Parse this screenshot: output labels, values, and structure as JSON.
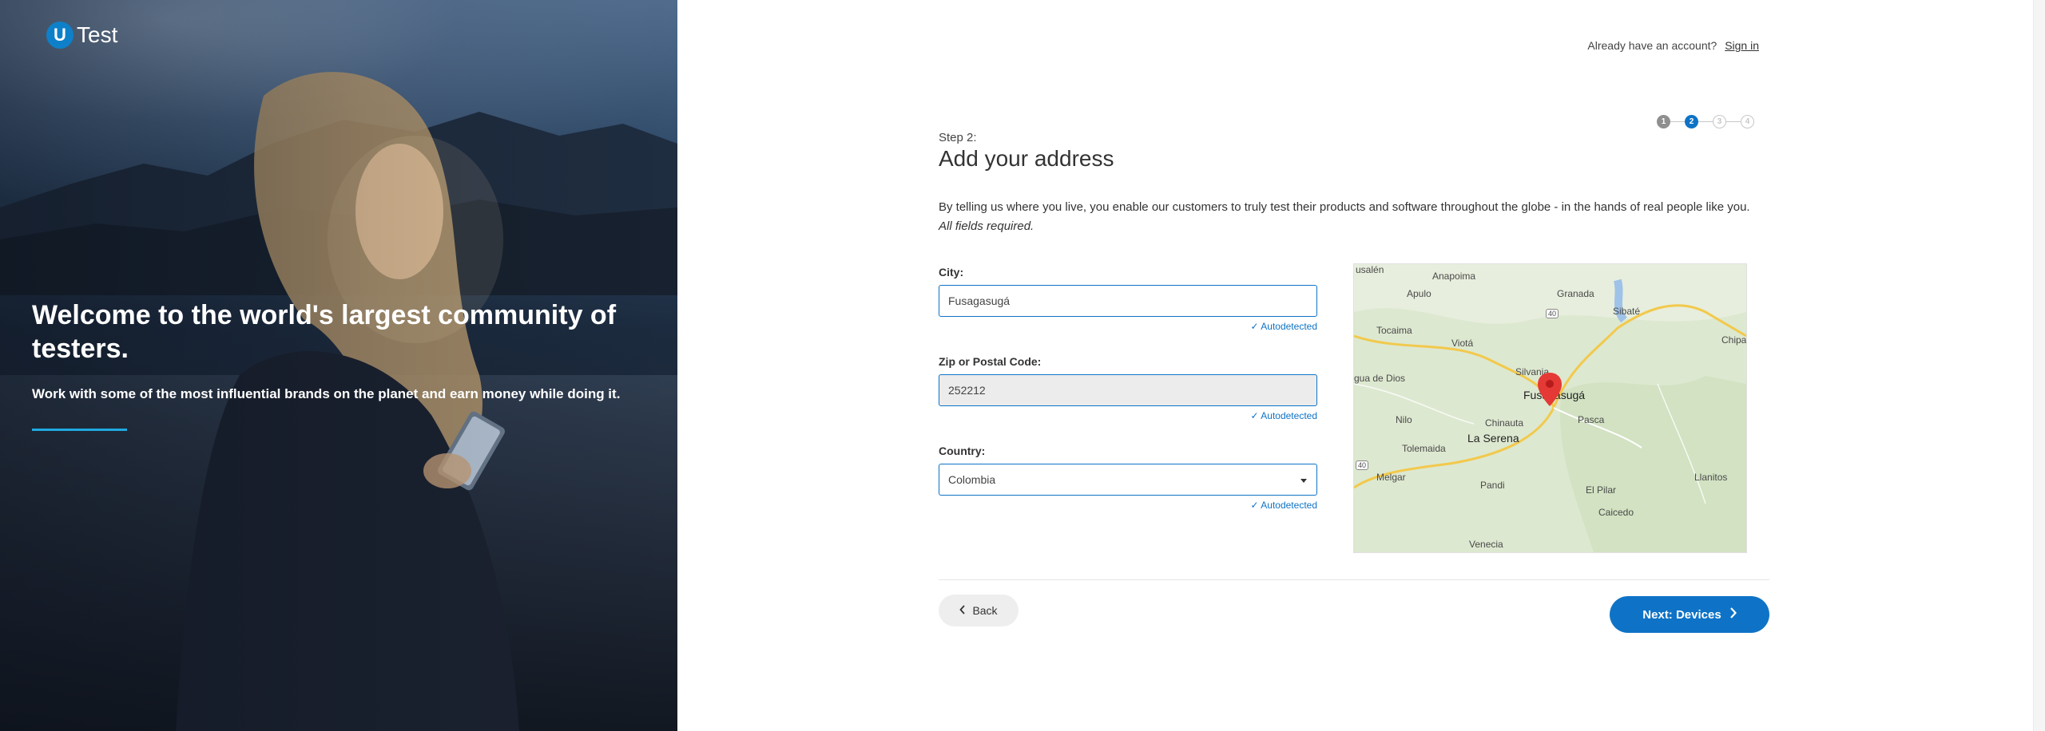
{
  "brand": {
    "logo_letter": "U",
    "logo_text": "Test",
    "accent": "#0e73c6"
  },
  "hero": {
    "title": "Welcome to the world's largest community of testers.",
    "subtitle": "Work with some of the most influential brands on the planet and earn money while doing it."
  },
  "header": {
    "account_prompt": "Already have an account?",
    "sign_in_label": "Sign in"
  },
  "stepper": {
    "steps": [
      "1",
      "2",
      "3",
      "4"
    ],
    "current": 2
  },
  "form": {
    "step_label": "Step 2:",
    "title": "Add your address",
    "intro_text": "By telling us where you live, you enable our customers to truly test their products and software throughout the globe - in the hands of real people like you.",
    "intro_required": "All fields required.",
    "city": {
      "label": "City:",
      "value": "Fusagasugá",
      "hint": "✓ Autodetected"
    },
    "zip": {
      "label": "Zip or Postal Code:",
      "value": "252212",
      "hint": "✓ Autodetected"
    },
    "country": {
      "label": "Country:",
      "value": "Colombia",
      "hint": "✓ Autodetected"
    }
  },
  "map": {
    "labels": [
      "usalén",
      "Anapoima",
      "Apulo",
      "Granada",
      "Sibaté",
      "Tocaima",
      "Viotá",
      "Chipa",
      "gua de Dios",
      "Silvania",
      "Fusagasugá",
      "Nilo",
      "Chinauta",
      "Pasca",
      "Tolemaida",
      "La Serena",
      "Melgar",
      "Pandi",
      "Llanitos",
      "El Pilar",
      "Caicedo",
      "Venecia",
      "40",
      "40"
    ],
    "marker": "Fusagasugá"
  },
  "actions": {
    "back_label": "Back",
    "next_label": "Next: Devices"
  }
}
